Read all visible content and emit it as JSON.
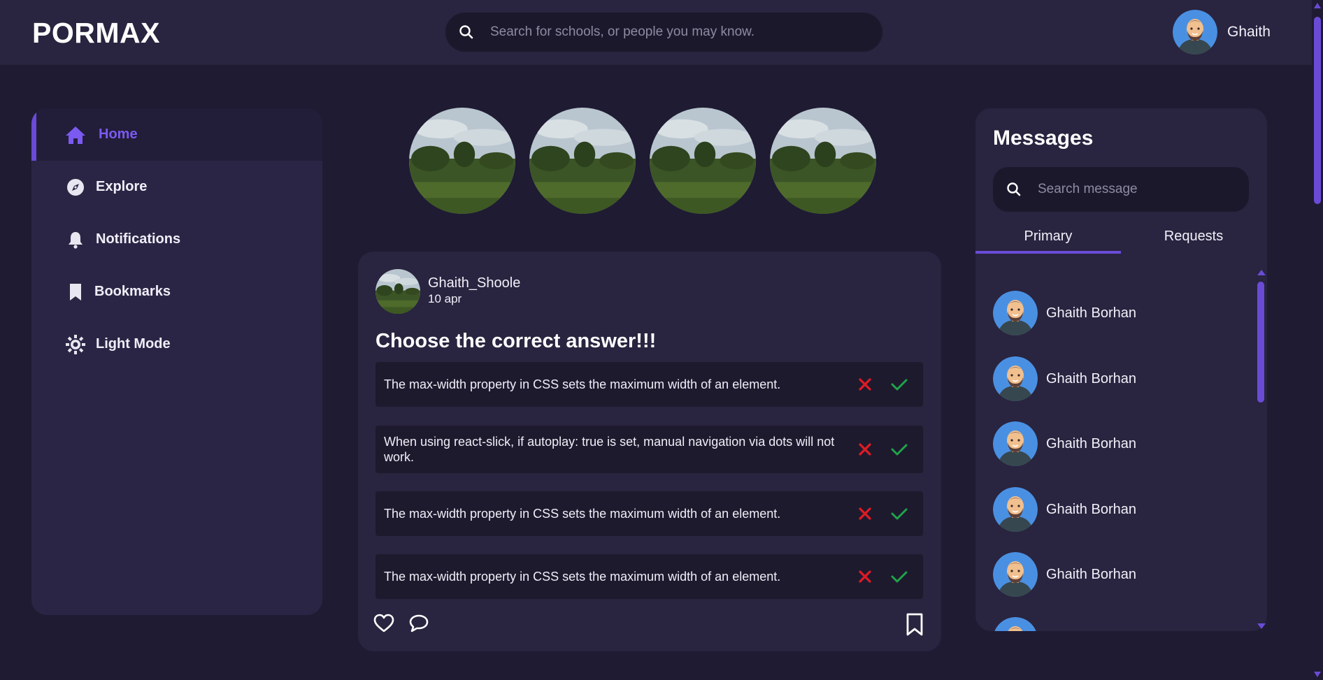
{
  "app": {
    "logo": "PORMAX",
    "search_placeholder": "Search for schools, or people you may know.",
    "user_name": "Ghaith"
  },
  "sidebar": {
    "items": [
      {
        "label": "Home",
        "icon": "home-icon",
        "active": true
      },
      {
        "label": "Explore",
        "icon": "compass-icon",
        "active": false
      },
      {
        "label": "Notifications",
        "icon": "bell-icon",
        "active": false
      },
      {
        "label": "Bookmarks",
        "icon": "bookmark-icon",
        "active": false
      },
      {
        "label": "Light Mode",
        "icon": "sun-icon",
        "active": false
      }
    ]
  },
  "post": {
    "author": "Ghaith_Shoole",
    "date": "10 apr",
    "title": "Choose the correct answer!!!",
    "answers": [
      "The max-width property in CSS sets the maximum width of an element.",
      "When using react-slick, if autoplay: true is set, manual navigation via dots will not work.",
      "The max-width property in CSS sets the maximum width of an element.",
      "The max-width property in CSS sets the maximum width of an element."
    ]
  },
  "messages": {
    "title": "Messages",
    "search_placeholder": "Search message",
    "tabs": [
      {
        "label": "Primary",
        "active": true
      },
      {
        "label": "Requests",
        "active": false
      }
    ],
    "contacts": [
      {
        "name": "Ghaith Borhan"
      },
      {
        "name": "Ghaith Borhan"
      },
      {
        "name": "Ghaith Borhan"
      },
      {
        "name": "Ghaith Borhan"
      },
      {
        "name": "Ghaith Borhan"
      }
    ]
  },
  "colors": {
    "accent": "#6a4bd6",
    "background": "#1f1b33",
    "panel": "#29243f",
    "wrong": "#e01b24",
    "correct": "#1fa34a"
  }
}
